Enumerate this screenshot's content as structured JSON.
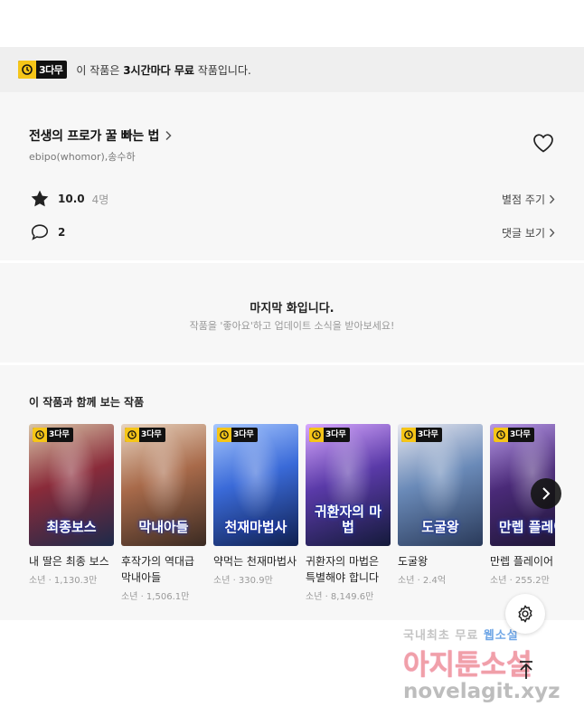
{
  "notice": {
    "badge": "3다무",
    "text_prefix": "이 작품은 ",
    "text_bold": "3시간마다 무료",
    "text_suffix": " 작품입니다."
  },
  "series": {
    "title": "전생의 프로가 꿀 빠는 법",
    "authors": "ebipo(whomor),송수하",
    "rating": "10.0",
    "rating_count": "4명",
    "rate_action": "별점 주기",
    "comments": "2",
    "comments_action": "댓글 보기"
  },
  "last_episode": {
    "heading": "마지막 화입니다.",
    "sub": "작품을 '좋아요'하고 업데이트 소식을 받아보세요!"
  },
  "recommend": {
    "title": "이 작품과 함께 보는 작품",
    "badge": "3다무",
    "items": [
      {
        "name": "내 딸은 최종 보스",
        "meta": "소년 · 1,130.3만",
        "logo": "최종보스",
        "colors": [
          "#1d2a4a",
          "#8a2b3a",
          "#d9c6a8"
        ]
      },
      {
        "name": "후작가의 역대급 막내아들",
        "meta": "소년 · 1,506.1만",
        "logo": "막내아들",
        "colors": [
          "#3a2a22",
          "#a86a4a",
          "#e8d4c0"
        ]
      },
      {
        "name": "약먹는 천재마법사",
        "meta": "소년 · 330.9만",
        "logo": "천재마법사",
        "colors": [
          "#102050",
          "#3a6ad8",
          "#a8c8ff"
        ]
      },
      {
        "name": "귀환자의 마법은 특별해야 합니다",
        "meta": "소년 · 8,149.6만",
        "logo": "귀환자의 마법",
        "colors": [
          "#141a3a",
          "#5a3aa8",
          "#d8a8ff"
        ]
      },
      {
        "name": "도굴왕",
        "meta": "소년 · 2.4억",
        "logo": "도굴왕",
        "colors": [
          "#2a3a5a",
          "#6a8ab8",
          "#e8e8f0"
        ]
      },
      {
        "name": "만렙 플레이어",
        "meta": "소년 · 255.2만",
        "logo": "만렙 플레이",
        "colors": [
          "#1a1430",
          "#4a2a78",
          "#b89ae8"
        ]
      }
    ]
  },
  "watermark": {
    "line1a": "국내최초 무료",
    "line1b": "웹소설",
    "line2": "아지툰소설",
    "line3": "novelagit.xyz"
  }
}
